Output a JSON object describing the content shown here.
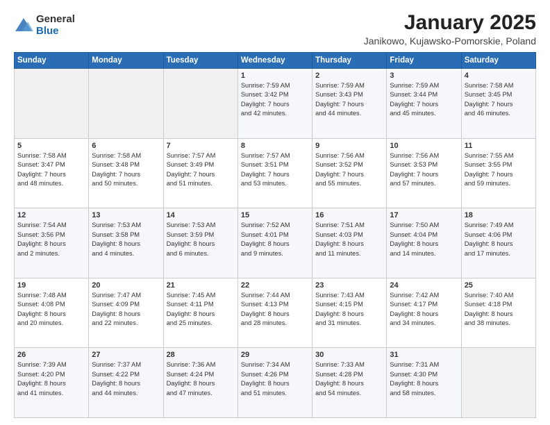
{
  "logo": {
    "general": "General",
    "blue": "Blue"
  },
  "header": {
    "month": "January 2025",
    "location": "Janikowo, Kujawsko-Pomorskie, Poland"
  },
  "weekdays": [
    "Sunday",
    "Monday",
    "Tuesday",
    "Wednesday",
    "Thursday",
    "Friday",
    "Saturday"
  ],
  "weeks": [
    [
      {
        "day": "",
        "info": ""
      },
      {
        "day": "",
        "info": ""
      },
      {
        "day": "",
        "info": ""
      },
      {
        "day": "1",
        "info": "Sunrise: 7:59 AM\nSunset: 3:42 PM\nDaylight: 7 hours\nand 42 minutes."
      },
      {
        "day": "2",
        "info": "Sunrise: 7:59 AM\nSunset: 3:43 PM\nDaylight: 7 hours\nand 44 minutes."
      },
      {
        "day": "3",
        "info": "Sunrise: 7:59 AM\nSunset: 3:44 PM\nDaylight: 7 hours\nand 45 minutes."
      },
      {
        "day": "4",
        "info": "Sunrise: 7:58 AM\nSunset: 3:45 PM\nDaylight: 7 hours\nand 46 minutes."
      }
    ],
    [
      {
        "day": "5",
        "info": "Sunrise: 7:58 AM\nSunset: 3:47 PM\nDaylight: 7 hours\nand 48 minutes."
      },
      {
        "day": "6",
        "info": "Sunrise: 7:58 AM\nSunset: 3:48 PM\nDaylight: 7 hours\nand 50 minutes."
      },
      {
        "day": "7",
        "info": "Sunrise: 7:57 AM\nSunset: 3:49 PM\nDaylight: 7 hours\nand 51 minutes."
      },
      {
        "day": "8",
        "info": "Sunrise: 7:57 AM\nSunset: 3:51 PM\nDaylight: 7 hours\nand 53 minutes."
      },
      {
        "day": "9",
        "info": "Sunrise: 7:56 AM\nSunset: 3:52 PM\nDaylight: 7 hours\nand 55 minutes."
      },
      {
        "day": "10",
        "info": "Sunrise: 7:56 AM\nSunset: 3:53 PM\nDaylight: 7 hours\nand 57 minutes."
      },
      {
        "day": "11",
        "info": "Sunrise: 7:55 AM\nSunset: 3:55 PM\nDaylight: 7 hours\nand 59 minutes."
      }
    ],
    [
      {
        "day": "12",
        "info": "Sunrise: 7:54 AM\nSunset: 3:56 PM\nDaylight: 8 hours\nand 2 minutes."
      },
      {
        "day": "13",
        "info": "Sunrise: 7:53 AM\nSunset: 3:58 PM\nDaylight: 8 hours\nand 4 minutes."
      },
      {
        "day": "14",
        "info": "Sunrise: 7:53 AM\nSunset: 3:59 PM\nDaylight: 8 hours\nand 6 minutes."
      },
      {
        "day": "15",
        "info": "Sunrise: 7:52 AM\nSunset: 4:01 PM\nDaylight: 8 hours\nand 9 minutes."
      },
      {
        "day": "16",
        "info": "Sunrise: 7:51 AM\nSunset: 4:03 PM\nDaylight: 8 hours\nand 11 minutes."
      },
      {
        "day": "17",
        "info": "Sunrise: 7:50 AM\nSunset: 4:04 PM\nDaylight: 8 hours\nand 14 minutes."
      },
      {
        "day": "18",
        "info": "Sunrise: 7:49 AM\nSunset: 4:06 PM\nDaylight: 8 hours\nand 17 minutes."
      }
    ],
    [
      {
        "day": "19",
        "info": "Sunrise: 7:48 AM\nSunset: 4:08 PM\nDaylight: 8 hours\nand 20 minutes."
      },
      {
        "day": "20",
        "info": "Sunrise: 7:47 AM\nSunset: 4:09 PM\nDaylight: 8 hours\nand 22 minutes."
      },
      {
        "day": "21",
        "info": "Sunrise: 7:45 AM\nSunset: 4:11 PM\nDaylight: 8 hours\nand 25 minutes."
      },
      {
        "day": "22",
        "info": "Sunrise: 7:44 AM\nSunset: 4:13 PM\nDaylight: 8 hours\nand 28 minutes."
      },
      {
        "day": "23",
        "info": "Sunrise: 7:43 AM\nSunset: 4:15 PM\nDaylight: 8 hours\nand 31 minutes."
      },
      {
        "day": "24",
        "info": "Sunrise: 7:42 AM\nSunset: 4:17 PM\nDaylight: 8 hours\nand 34 minutes."
      },
      {
        "day": "25",
        "info": "Sunrise: 7:40 AM\nSunset: 4:18 PM\nDaylight: 8 hours\nand 38 minutes."
      }
    ],
    [
      {
        "day": "26",
        "info": "Sunrise: 7:39 AM\nSunset: 4:20 PM\nDaylight: 8 hours\nand 41 minutes."
      },
      {
        "day": "27",
        "info": "Sunrise: 7:37 AM\nSunset: 4:22 PM\nDaylight: 8 hours\nand 44 minutes."
      },
      {
        "day": "28",
        "info": "Sunrise: 7:36 AM\nSunset: 4:24 PM\nDaylight: 8 hours\nand 47 minutes."
      },
      {
        "day": "29",
        "info": "Sunrise: 7:34 AM\nSunset: 4:26 PM\nDaylight: 8 hours\nand 51 minutes."
      },
      {
        "day": "30",
        "info": "Sunrise: 7:33 AM\nSunset: 4:28 PM\nDaylight: 8 hours\nand 54 minutes."
      },
      {
        "day": "31",
        "info": "Sunrise: 7:31 AM\nSunset: 4:30 PM\nDaylight: 8 hours\nand 58 minutes."
      },
      {
        "day": "",
        "info": ""
      }
    ]
  ]
}
